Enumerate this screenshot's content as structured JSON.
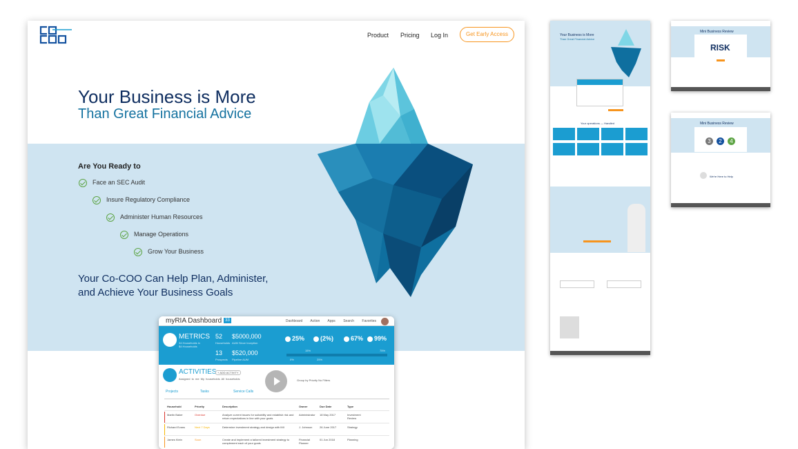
{
  "nav": {
    "items": [
      "Product",
      "Pricing",
      "Log In"
    ],
    "cta": "Get Early Access"
  },
  "hero": {
    "title_line1": "Your Business is More",
    "title_line2": "Than Great Financial Advice",
    "ready": "Are You Ready to",
    "steps": [
      "Face an SEC Audit",
      "Insure Regulatory Compliance",
      "Administer Human Resources",
      "Manage Operations",
      "Grow Your Business"
    ],
    "tagline_line1": "Your Co-COO Can Help Plan, Administer,",
    "tagline_line2": "and Achieve Your Business Goals"
  },
  "dashboard": {
    "title": "myRIA Dashboard",
    "badge": "33",
    "links": "Dashboard Action Apps Search Favorites",
    "metrics": {
      "title": "METRICS",
      "sub1": "34 Households in",
      "sub2": "$4 Households",
      "n1": "52",
      "l1": "Households",
      "n2": "13",
      "l2": "Prospects",
      "v1": "$5000,000",
      "lv1": "AUM Since Inception",
      "v2": "$520,000",
      "lv2": "Pipeline AUM",
      "pcts": [
        "25%",
        "(2%)",
        "67%",
        "99%"
      ],
      "bar_pcts": [
        "15%",
        "75%",
        "0%",
        "25%"
      ]
    },
    "activities": {
      "title": "ACTIVITIES",
      "add": "+ ADD ACTIVITY",
      "filter": "Assigned to me     My households     All households",
      "filter2": "Group by Priority     No Filters",
      "tabs": [
        "Projects",
        "Tasks",
        "Service Calls"
      ],
      "headers": [
        "Household",
        "Priority",
        "Description",
        "Owner",
        "Due Date",
        "Type"
      ],
      "rows": [
        {
          "household": "Martin Baker",
          "priority": "Overdue",
          "description": "Analyze current issues for suitability and establish risk and return expectations in line with your goals",
          "owner": "Administrator",
          "due": "18 May 2017",
          "type": "Investment Review",
          "color": "#d9342b"
        },
        {
          "household": "Richard Evans",
          "priority": "Next 7 Days",
          "description": "Determine investment strategy and design with IMI",
          "owner": "J. Johnson",
          "due": "26 June 2017",
          "type": "Strategy",
          "color": "#f7b500"
        },
        {
          "household": "James Klein",
          "priority": "Soon",
          "description": "Create and implement a tailored investment strategy to complement each of your goals",
          "owner": "Financial Planner",
          "due": "01 Jun 2018",
          "type": "Planning",
          "color": "#f7941d"
        }
      ]
    }
  },
  "thumb_text": {
    "t1_title": "Your Business is More",
    "t1_sub": "Than Great Financial Advice",
    "t1_ops": "Your operations — Handled",
    "t2_title": "Mini Business Review",
    "t2_risk": "RISK",
    "t3_title": "Mini Business Review",
    "t3_nums": [
      "3",
      "2",
      "4"
    ],
    "t3_were": "We're Here to Help"
  },
  "colors": {
    "navy": "#0e2d5f",
    "blue": "#1b9dd1",
    "orange": "#f7941d",
    "green": "#5da444",
    "band": "#cfe4f1"
  }
}
